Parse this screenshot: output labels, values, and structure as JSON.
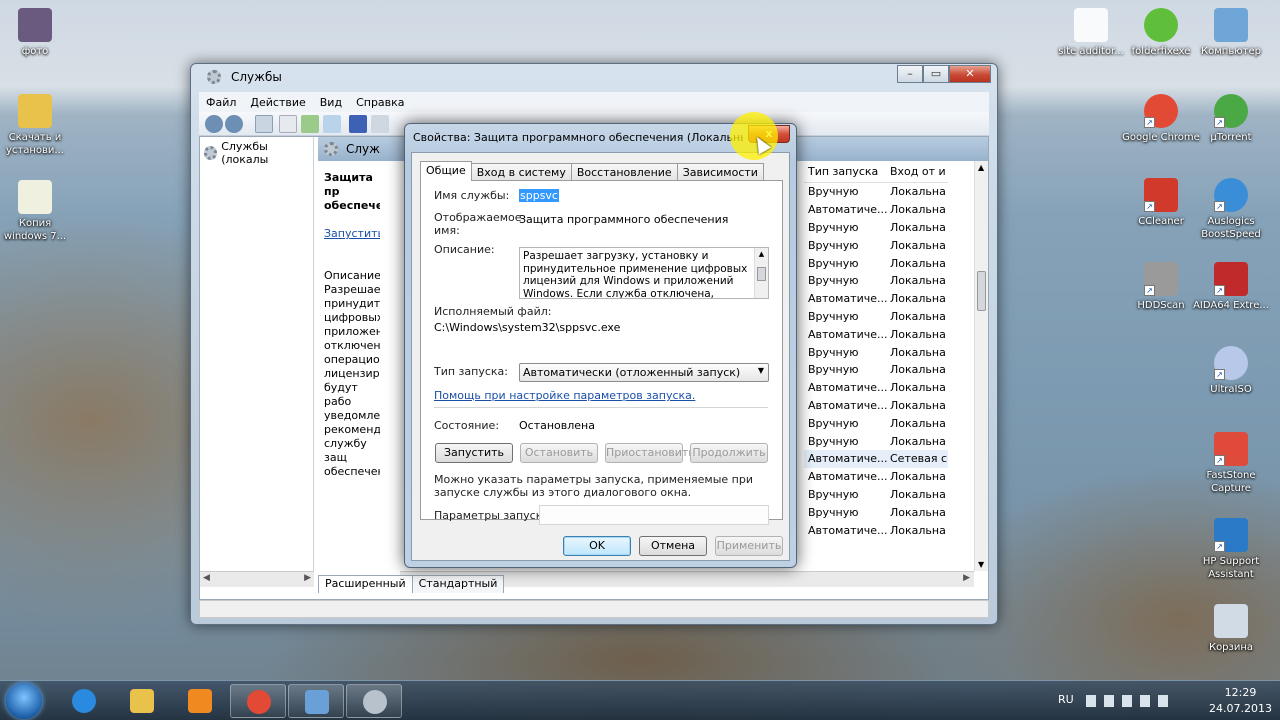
{
  "desktop_icons_left": [
    {
      "label": "фото",
      "icon": "photo-icon",
      "color": "#6a5a80"
    },
    {
      "label": "Скачать и установи...",
      "icon": "folder-icon",
      "color": "#e8c24a"
    },
    {
      "label": "Копия windows 7...",
      "icon": "file-icon",
      "color": "#f0f0e0"
    }
  ],
  "desktop_icons_right": [
    {
      "label": "site auditor...",
      "icon": "cursor-app-icon",
      "color": "#ffffff"
    },
    {
      "label": "folderfixexe",
      "icon": "checkmark-icon",
      "color": "#5fbf3a"
    },
    {
      "label": "Компьютер",
      "icon": "computer-icon",
      "color": "#6fa6d8"
    },
    {
      "label": "Google Chrome",
      "icon": "chrome-icon",
      "color": "#e24a35"
    },
    {
      "label": "µTorrent",
      "icon": "utorrent-icon",
      "color": "#4aa845"
    },
    {
      "label": "CCleaner",
      "icon": "ccleaner-icon",
      "color": "#d13a2a"
    },
    {
      "label": "Auslogics BoostSpeed",
      "icon": "boostspeed-icon",
      "color": "#3a8ed8"
    },
    {
      "label": "HDDScan",
      "icon": "hddscan-icon",
      "color": "#9a9a9a"
    },
    {
      "label": "AIDA64 Extre...",
      "icon": "aida64-icon",
      "color": "#c02a2a"
    },
    {
      "label": "UltraISO",
      "icon": "ultraiso-icon",
      "color": "#b8c8e8"
    },
    {
      "label": "FastStone Capture",
      "icon": "faststone-icon",
      "color": "#e04a3a"
    },
    {
      "label": "HP Support Assistant",
      "icon": "hp-support-icon",
      "color": "#2a7ac8"
    },
    {
      "label": "Корзина",
      "icon": "recycle-bin-icon",
      "color": "#d0dbe6"
    }
  ],
  "services_window": {
    "title": "Службы",
    "menu": [
      "Файл",
      "Действие",
      "Вид",
      "Справка"
    ],
    "tree_root": "Службы (локалы",
    "panel_header": "Служ",
    "desc_pane": {
      "name_lines": [
        "Защита пр",
        "обеспечен"
      ],
      "start_link": "Запустить",
      "desc_label": "Описание:",
      "desc_lines": [
        "Разрешает",
        "принудите",
        "цифровых",
        "приложен",
        "отключена",
        "операцион",
        "лицензиро",
        "будут рабо",
        "уведомлен",
        "рекоменду",
        "службу защ",
        "обеспечен"
      ]
    },
    "list_headers": [
      "Тип запуска",
      "Вход от и"
    ],
    "rows": [
      [
        "Вручную",
        "Локальна"
      ],
      [
        "Автоматиче...",
        "Локальна"
      ],
      [
        "Вручную",
        "Локальна"
      ],
      [
        "Вручную",
        "Локальна"
      ],
      [
        "Вручную",
        "Локальна"
      ],
      [
        "Вручную",
        "Локальна"
      ],
      [
        "Автоматиче...",
        "Локальна"
      ],
      [
        "Вручную",
        "Локальна"
      ],
      [
        "Автоматиче...",
        "Локальна"
      ],
      [
        "Вручную",
        "Локальна"
      ],
      [
        "Вручную",
        "Локальна"
      ],
      [
        "Автоматиче...",
        "Локальна"
      ],
      [
        "Автоматиче...",
        "Локальна"
      ],
      [
        "Вручную",
        "Локальна"
      ],
      [
        "Вручную",
        "Локальна"
      ],
      [
        "Автоматиче...",
        "Сетевая с"
      ],
      [
        "Автоматиче...",
        "Локальна"
      ],
      [
        "Вручную",
        "Локальна"
      ],
      [
        "Вручную",
        "Локальна"
      ],
      [
        "Автоматиче...",
        "Локальна"
      ]
    ],
    "bottom_tabs": [
      "Расширенный",
      "Стандартный"
    ]
  },
  "dialog": {
    "title": "Свойства: Защита программного обеспечения (Локальный ко...",
    "close": "x",
    "tabs": [
      "Общие",
      "Вход в систему",
      "Восстановление",
      "Зависимости"
    ],
    "service_name_label": "Имя службы:",
    "service_name_value": "sppsvc",
    "display_name_label": "Отображаемое имя:",
    "display_name_value": "Защита программного обеспечения",
    "description_label": "Описание:",
    "description_value": "Разрешает загрузку, установку и принудительное применение цифровых лицензий для Windows и приложений Windows. Если служба отключена, возможно,",
    "exe_label": "Исполняемый файл:",
    "exe_value": "C:\\Windows\\system32\\sppsvc.exe",
    "startup_label": "Тип запуска:",
    "startup_value": "Автоматически (отложенный запуск)",
    "help_link": "Помощь при настройке параметров запуска.",
    "state_label": "Состояние:",
    "state_value": "Остановлена",
    "btn_start": "Запустить",
    "btn_stop": "Остановить",
    "btn_pause": "Приостановить",
    "btn_resume": "Продолжить",
    "hint": "Можно указать параметры запуска, применяемые при запуске службы из этого диалогового окна.",
    "params_label": "Параметры запуска:",
    "params_value": "",
    "ok": "OK",
    "cancel": "Отмена",
    "apply": "Применить"
  },
  "taskbar": {
    "lang": "RU",
    "time": "12:29",
    "date": "24.07.2013",
    "items": [
      {
        "icon": "internet-explorer-icon",
        "color": "#2a8ae0",
        "open": false
      },
      {
        "icon": "explorer-folder-icon",
        "color": "#e8c24a",
        "open": false
      },
      {
        "icon": "media-player-icon",
        "color": "#f08a20",
        "open": false
      },
      {
        "icon": "chrome-icon",
        "color": "#e24a35",
        "open": true
      },
      {
        "icon": "control-panel-icon",
        "color": "#6aa0d8",
        "open": true
      },
      {
        "icon": "services-gear-icon",
        "color": "#b8c2cc",
        "open": true
      }
    ]
  }
}
